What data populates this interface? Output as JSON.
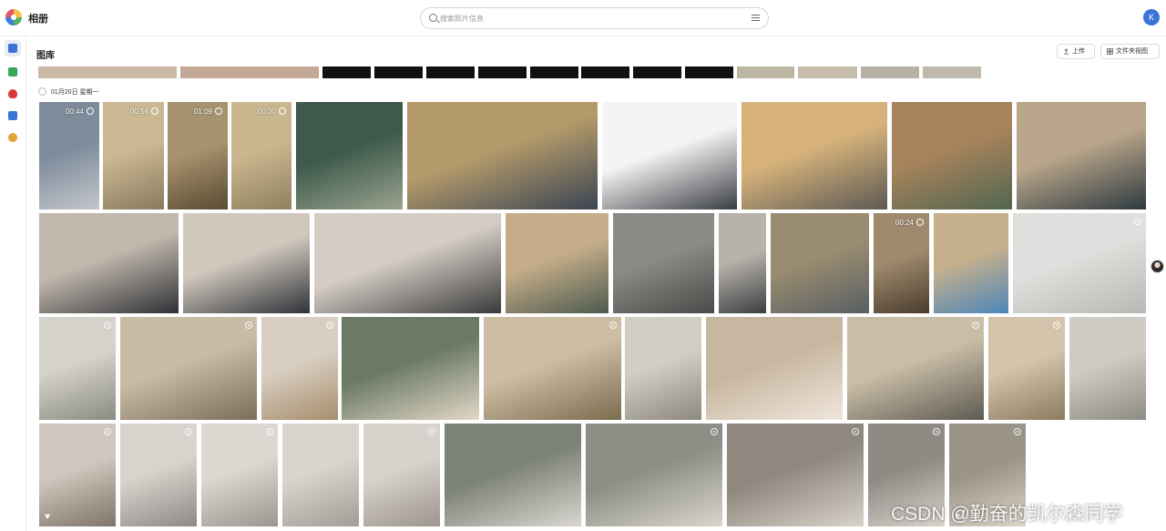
{
  "app": {
    "title": "相册",
    "avatar_letter": "K"
  },
  "search": {
    "placeholder": "搜索照片信息",
    "value": ""
  },
  "nav": [
    {
      "name": "nav-photos",
      "icon": "photo-icon",
      "color": "#3b73d8",
      "active": true
    },
    {
      "name": "nav-albums",
      "icon": "albums-icon",
      "color": "#3aa757",
      "active": false
    },
    {
      "name": "nav-favorites",
      "icon": "heart-icon",
      "color": "#d93b3b",
      "active": false
    },
    {
      "name": "nav-screen",
      "icon": "screen-icon",
      "color": "#3b73d8",
      "active": false
    },
    {
      "name": "nav-people",
      "icon": "people-icon",
      "color": "#e3a534",
      "active": false
    }
  ],
  "header": {
    "title": "图库",
    "upload_label": "上传",
    "folder_view_label": "文件夹视图"
  },
  "section": {
    "date_label": "01月20日 星期一"
  },
  "rows": [
    [
      {
        "kind": "video",
        "duration": "00:44",
        "colors": [
          "#7e8b9b",
          "#c4c7cc"
        ]
      },
      {
        "kind": "video",
        "duration": "00:56",
        "colors": [
          "#cbb893",
          "#8a7a5e"
        ]
      },
      {
        "kind": "video",
        "duration": "01:09",
        "colors": [
          "#a7936f",
          "#5b4a32"
        ]
      },
      {
        "kind": "video",
        "duration": "00:30",
        "colors": [
          "#c9b78f",
          "#91805f"
        ]
      },
      {
        "kind": "photo",
        "colors": [
          "#3d5a4b",
          "#9aa38f"
        ]
      },
      {
        "kind": "photo",
        "colors": [
          "#b49a6a",
          "#3b4553"
        ]
      },
      {
        "kind": "photo",
        "colors": [
          "#f4f4f4",
          "#3a3d42"
        ]
      },
      {
        "kind": "photo",
        "colors": [
          "#d6b27a",
          "#5d5954"
        ]
      },
      {
        "kind": "photo",
        "colors": [
          "#a7835c",
          "#52664f"
        ]
      },
      {
        "kind": "photo",
        "colors": [
          "#b9a58a",
          "#2e3a40"
        ]
      }
    ],
    [
      {
        "kind": "photo",
        "colors": [
          "#c1b8ad",
          "#2f3135"
        ]
      },
      {
        "kind": "photo",
        "colors": [
          "#d0c8bd",
          "#2f3238"
        ]
      },
      {
        "kind": "photo",
        "colors": [
          "#d4cdc5",
          "#3a3a3a"
        ]
      },
      {
        "kind": "photo",
        "colors": [
          "#c4ad88",
          "#4d5a4f"
        ]
      },
      {
        "kind": "photo",
        "colors": [
          "#8a8b87",
          "#4a4b48"
        ]
      },
      {
        "kind": "photo",
        "colors": [
          "#b7b2aa",
          "#3d3f42"
        ]
      },
      {
        "kind": "photo",
        "colors": [
          "#9a8c70",
          "#595f63"
        ]
      },
      {
        "kind": "video",
        "duration": "00:24",
        "colors": [
          "#9f8a6e",
          "#4a3c2d"
        ]
      },
      {
        "kind": "photo",
        "colors": [
          "#c6b08c",
          "#4c86b9"
        ]
      },
      {
        "kind": "live",
        "colors": [
          "#dfe0dd",
          "#b8b9b4"
        ]
      }
    ],
    [
      {
        "kind": "live",
        "colors": [
          "#d5d1cb",
          "#8a8c80"
        ]
      },
      {
        "kind": "live",
        "colors": [
          "#c9bca6",
          "#7b6e5a"
        ]
      },
      {
        "kind": "live",
        "colors": [
          "#d8cfc2",
          "#a88d6d"
        ]
      },
      {
        "kind": "photo",
        "colors": [
          "#6b7a64",
          "#e3d8c8"
        ]
      },
      {
        "kind": "live",
        "colors": [
          "#cdbda4",
          "#7b6c4e"
        ]
      },
      {
        "kind": "photo",
        "colors": [
          "#d2cdc5",
          "#8d8980"
        ]
      },
      {
        "kind": "photo",
        "colors": [
          "#c8b7a0",
          "#efe6dc"
        ]
      },
      {
        "kind": "live",
        "colors": [
          "#c8bda6",
          "#5e5a52"
        ]
      },
      {
        "kind": "live",
        "colors": [
          "#d4c4ac",
          "#8d7b5f"
        ]
      },
      {
        "kind": "photo",
        "colors": [
          "#cfcac4",
          "#8e8a84"
        ]
      }
    ],
    [
      {
        "kind": "live",
        "favorite": true,
        "colors": [
          "#cfc7bd",
          "#7e7468"
        ]
      },
      {
        "kind": "live",
        "colors": [
          "#d8d3cc",
          "#8d8a86"
        ]
      },
      {
        "kind": "live",
        "colors": [
          "#dcd7d0",
          "#9a9690"
        ]
      },
      {
        "kind": "photo",
        "colors": [
          "#d9d4ce",
          "#a19d96"
        ]
      },
      {
        "kind": "live",
        "colors": [
          "#d7d2cb",
          "#9c958d"
        ]
      },
      {
        "kind": "photo",
        "colors": [
          "#7d8278",
          "#d9d6d0"
        ]
      },
      {
        "kind": "live",
        "colors": [
          "#8b8f86",
          "#dbd5cc"
        ]
      },
      {
        "kind": "live",
        "colors": [
          "#8e887e",
          "#d8d2ca"
        ]
      },
      {
        "kind": "live",
        "colors": [
          "#8f8a84",
          "#d9d3cb"
        ]
      },
      {
        "kind": "live",
        "favorite": true,
        "colors": [
          "#9b9488",
          "#dcd5ca"
        ]
      }
    ]
  ],
  "watermark": "CSDN @勤奋的凯尔森同学"
}
